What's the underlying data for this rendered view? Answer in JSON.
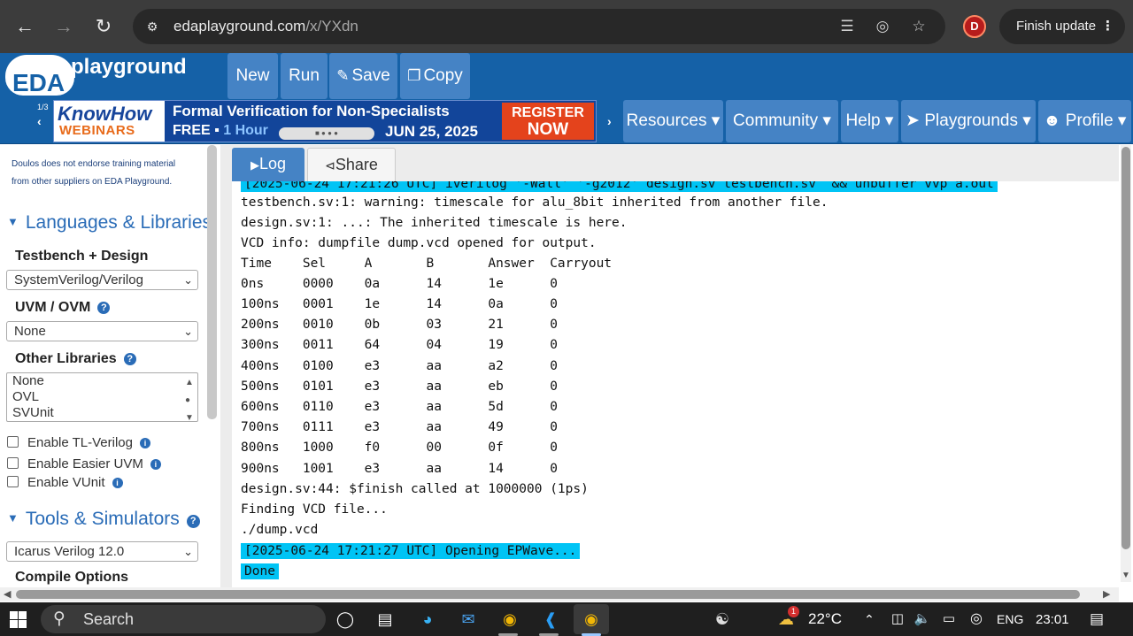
{
  "browser": {
    "url_host": "edaplayground.com",
    "url_path": "/x/YXdn",
    "finish_update": "Finish update",
    "extension_letter": "D"
  },
  "toolbar": {
    "logo_eda": "EDA",
    "logo_playground": "playground",
    "new": "New",
    "run": "Run",
    "save": "Save",
    "copy": "Copy"
  },
  "banner": {
    "counter": "1/3",
    "brand_top": "KnowHow",
    "brand_bottom": "WEBINARS",
    "title": "Formal Verification for Non-Specialists",
    "free": "FREE",
    "hour": "1 Hour",
    "date": "JUN 25, 2025",
    "cta_line1": "REGISTER",
    "cta_line2": "NOW"
  },
  "menu": {
    "resources": "Resources",
    "community": "Community",
    "help": "Help",
    "playgrounds": "Playgrounds",
    "profile": "Profile"
  },
  "sidebar": {
    "note_line1": "Doulos does not endorse training material",
    "note_line2": "from other suppliers on EDA Playground.",
    "languages_title": "Languages & Libraries",
    "testbench_label": "Testbench + Design",
    "testbench_value": "SystemVerilog/Verilog",
    "uvm_label": "UVM / OVM",
    "uvm_value": "None",
    "other_libs_label": "Other Libraries",
    "other_libs_options": [
      "None",
      "OVL",
      "SVUnit"
    ],
    "enable_tl_verilog": "Enable TL-Verilog",
    "enable_easier_uvm": "Enable Easier UVM",
    "enable_vunit": "Enable VUnit",
    "tools_title": "Tools & Simulators",
    "simulator_value": "Icarus Verilog 12.0",
    "compile_options": "Compile Options"
  },
  "tabs": {
    "log": "Log",
    "share": "Share"
  },
  "log": {
    "lines": [
      "[2025-06-24 17:21:26 UTC] iverilog '-Wall' '-g2012' design.sv testbench.sv  && unbuffer vvp a.out",
      "testbench.sv:1: warning: timescale for alu_8bit inherited from another file.",
      "design.sv:1: ...: The inherited timescale is here.",
      "VCD info: dumpfile dump.vcd opened for output.",
      "Time    Sel     A       B       Answer  Carryout",
      "0ns     0000    0a      14      1e      0",
      "100ns   0001    1e      14      0a      0",
      "200ns   0010    0b      03      21      0",
      "300ns   0011    64      04      19      0",
      "400ns   0100    e3      aa      a2      0",
      "500ns   0101    e3      aa      eb      0",
      "600ns   0110    e3      aa      5d      0",
      "700ns   0111    e3      aa      49      0",
      "800ns   1000    f0      00      0f      0",
      "900ns   1001    e3      aa      14      0",
      "design.sv:44: $finish called at 1000000 (1ps)",
      "Finding VCD file...",
      "./dump.vcd",
      "[2025-06-24 17:21:27 UTC] Opening EPWave...",
      "Done"
    ]
  },
  "taskbar": {
    "search": "Search",
    "temperature": "22°C",
    "language": "ENG",
    "time": "23:01",
    "weather_badge": "1"
  },
  "colors": {
    "header_blue": "#1561a7",
    "button_blue": "#4583c5",
    "highlight_cyan": "#00c4f5",
    "sidebar_title": "#2a6cb7"
  }
}
